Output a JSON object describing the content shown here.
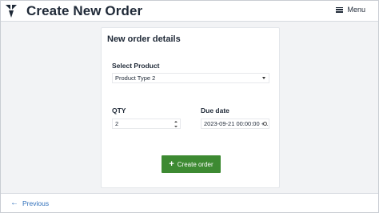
{
  "header": {
    "title": "Create New Order",
    "menu_label": "Menu"
  },
  "card": {
    "title": "New order details",
    "product": {
      "label": "Select Product",
      "value": "Product Type 2"
    },
    "qty": {
      "label": "QTY",
      "value": "2"
    },
    "due_date": {
      "label": "Due date",
      "value": "2023-09-21 00:00:00 +..."
    },
    "create_button_label": "Create order"
  },
  "footer": {
    "previous_label": "Previous"
  },
  "colors": {
    "primary_button": "#3d8a32",
    "link": "#2f6fba"
  }
}
